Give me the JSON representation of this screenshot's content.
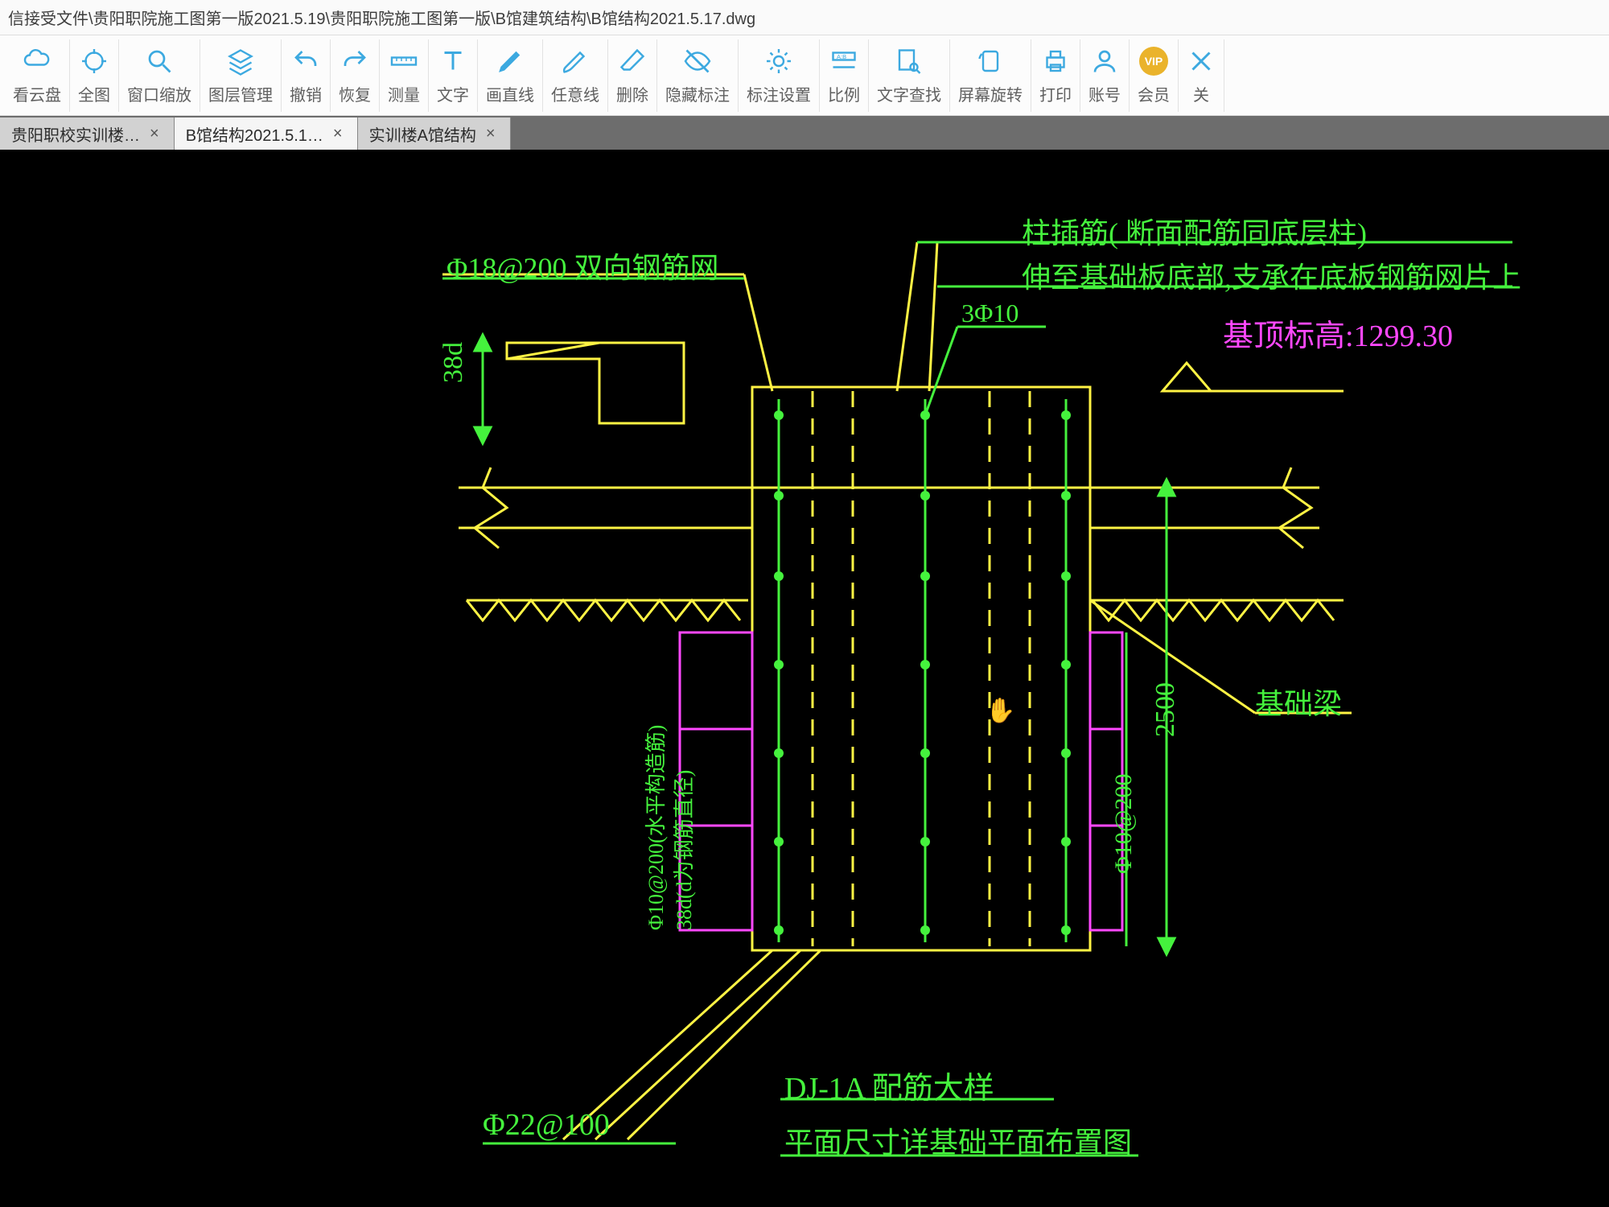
{
  "title_bar": "信接受文件\\贵阳职院施工图第一版2021.5.19\\贵阳职院施工图第一版\\B馆建筑结构\\B馆结构2021.5.17.dwg",
  "toolbar": [
    {
      "name": "cloud-view",
      "icon": "cloud",
      "label": "看云盘"
    },
    {
      "name": "full-view",
      "icon": "target",
      "label": "全图"
    },
    {
      "name": "window-zoom",
      "icon": "magnify",
      "label": "窗口缩放"
    },
    {
      "name": "layer-mgr",
      "icon": "layers",
      "label": "图层管理"
    },
    {
      "name": "undo",
      "icon": "undo",
      "label": "撤销"
    },
    {
      "name": "redo",
      "icon": "redo",
      "label": "恢复"
    },
    {
      "name": "measure",
      "icon": "ruler",
      "label": "测量"
    },
    {
      "name": "text",
      "icon": "text-t",
      "label": "文字"
    },
    {
      "name": "line",
      "icon": "pencil",
      "label": "画直线"
    },
    {
      "name": "freehand",
      "icon": "pen",
      "label": "任意线"
    },
    {
      "name": "erase",
      "icon": "eraser",
      "label": "删除"
    },
    {
      "name": "hide-annot",
      "icon": "eye-off",
      "label": "隐藏标注"
    },
    {
      "name": "annot-settings",
      "icon": "annot-gear",
      "label": "标注设置"
    },
    {
      "name": "ratio",
      "icon": "ratio",
      "label": "比例"
    },
    {
      "name": "find-text",
      "icon": "search-doc",
      "label": "文字查找"
    },
    {
      "name": "rotate-screen",
      "icon": "rotate",
      "label": "屏幕旋转"
    },
    {
      "name": "print",
      "icon": "printer",
      "label": "打印"
    },
    {
      "name": "account",
      "icon": "user",
      "label": "账号"
    },
    {
      "name": "vip",
      "icon": "vip",
      "label": "会员"
    },
    {
      "name": "close",
      "icon": "close",
      "label": "关"
    }
  ],
  "tabs": [
    {
      "label": "贵阳职校实训楼…",
      "active": false
    },
    {
      "label": "B馆结构2021.5.1…",
      "active": true
    },
    {
      "label": "实训楼A馆结构",
      "active": false
    }
  ],
  "drawing": {
    "top_rebar_label": "Φ18@200 双向钢筋网",
    "bottom_rebar_label": "Φ22@100",
    "annot1": "柱插筋( 断面配筋同底层柱)",
    "annot2": "伸至基础板底部,支承在底板钢筋网片上",
    "elevation_label": "基顶标高:1299.30",
    "beam_label": "基础梁",
    "stirrup_label": "3Φ10",
    "left_dim": "38d",
    "right_dim": "2500",
    "right_rebar": "Φ10@200",
    "left_vert1": "Φ10@200(水平构造筋)",
    "left_vert2": "38d(d为钢筋直径)",
    "detail_title": "DJ-1A 配筋大样",
    "detail_sub": "平面尺寸详基础平面布置图"
  }
}
